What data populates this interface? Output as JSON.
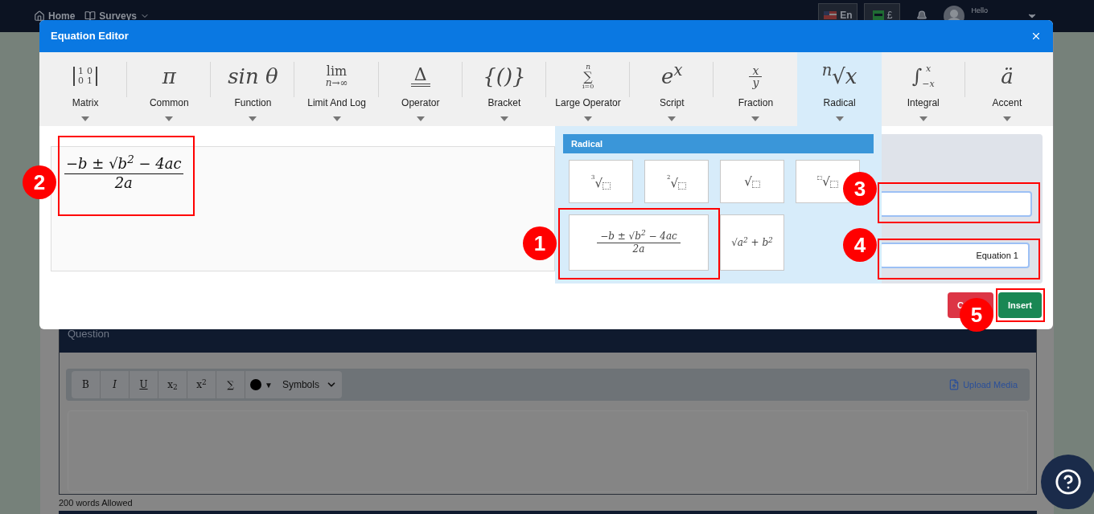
{
  "nav": {
    "items": [
      {
        "label": "Home",
        "kind": "home"
      },
      {
        "label": "Surveys",
        "kind": "surveys"
      }
    ],
    "language": "En",
    "currency": "£",
    "greeting": "Hello"
  },
  "editor": {
    "title": "Equation Editor",
    "tools": [
      {
        "label": "Matrix",
        "kind": "matrix",
        "cells": [
          "1",
          "0",
          "0",
          "1"
        ],
        "selected": false
      },
      {
        "label": "Common",
        "kind": "plain",
        "symbol": "π",
        "selected": false
      },
      {
        "label": "Function",
        "kind": "plain",
        "symbol": "sin θ",
        "selected": false
      },
      {
        "label": "Limit And Log",
        "kind": "stack",
        "symbol": "lim",
        "sub": "n→∞",
        "selected": false
      },
      {
        "label": "Operator",
        "kind": "underlined",
        "symbol": "Δ",
        "selected": false
      },
      {
        "label": "Bracket",
        "kind": "plain",
        "symbol": "{()}",
        "selected": false
      },
      {
        "label": "Large Operator",
        "kind": "big-operator",
        "symbol": "∑",
        "sup": "n",
        "sub": "i=0",
        "selected": false
      },
      {
        "label": "Script",
        "kind": "plain",
        "symbol": "e$^{x}$",
        "selected": false
      },
      {
        "label": "Fraction",
        "kind": "fraction",
        "top": "x",
        "bottom": "y",
        "selected": false
      },
      {
        "label": "Radical",
        "kind": "plain",
        "symbol": "$^{n}$√x",
        "selected": true
      },
      {
        "label": "Integral",
        "kind": "integral",
        "symbol": "∫",
        "sup": "x",
        "sub": "−x",
        "selected": false
      },
      {
        "label": "Accent",
        "kind": "plain",
        "symbol": "ä",
        "selected": false
      }
    ],
    "formula": {
      "numerator": "−b ± √b$^{2}$ − 4ac",
      "denominator": "2a"
    },
    "dropdown": {
      "title": "Radical",
      "items": [
        {
          "kind": "indexed-root",
          "index": "3",
          "radical": "√"
        },
        {
          "kind": "indexed-root",
          "index": "2",
          "radical": "√"
        },
        {
          "kind": "square-root",
          "radical": "√"
        },
        {
          "kind": "box-root",
          "radical": "√"
        },
        {
          "kind": "fraction",
          "numerator": "−b ± √b$^{2}$ − 4ac",
          "denominator": "2a"
        },
        {
          "kind": "expression",
          "text": "√a$^{2}$ + b$^{2}$"
        }
      ]
    },
    "fields": [
      {
        "focused": true
      },
      {
        "value": "Equation 1",
        "focused": true
      }
    ],
    "buttons": [
      {
        "label": "C",
        "kind": "cancel"
      },
      {
        "label": "Insert",
        "kind": "insert"
      }
    ]
  },
  "question": {
    "title": "Question",
    "format_buttons": [
      "B",
      "I",
      "U",
      "x$_{2}$",
      "x$^{2}$",
      "∑"
    ],
    "color_arrow": "▼",
    "symbols": "Symbols",
    "upload": "Upload Media",
    "note": "200 words Allowed"
  },
  "annotations": [
    {
      "number": "1"
    },
    {
      "number": "2"
    },
    {
      "number": "3"
    },
    {
      "number": "4"
    },
    {
      "number": "5"
    }
  ]
}
